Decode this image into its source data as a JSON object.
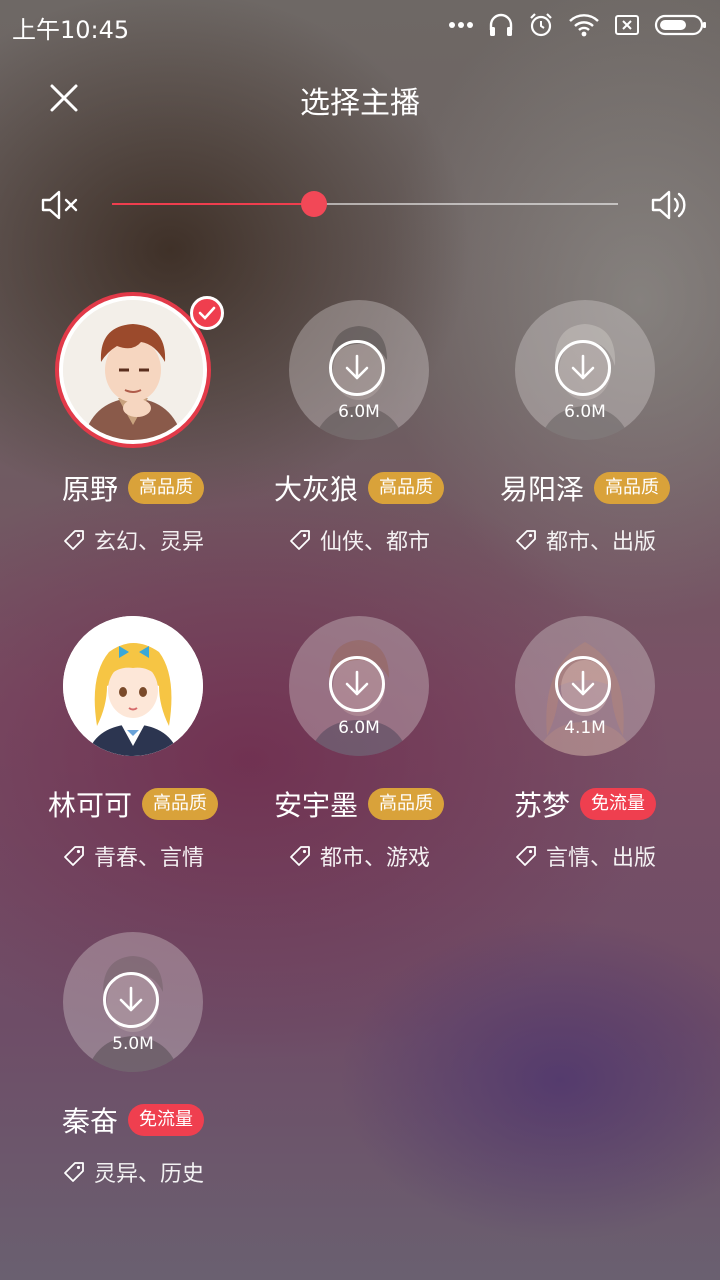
{
  "status_bar": {
    "time": "上午10:45",
    "icons": [
      "more-dots-icon",
      "headphones-icon",
      "alarm-icon",
      "wifi-icon",
      "no-sim-icon",
      "battery-icon"
    ]
  },
  "header": {
    "title": "选择主播",
    "close_icon": "close-icon"
  },
  "volume": {
    "level": 0.4,
    "mute_icon": "volume-mute-icon",
    "up_icon": "volume-up-icon",
    "accent": "#ef3e4e"
  },
  "anchors": [
    {
      "name": "原野",
      "badge": "高品质",
      "badge_type": "gold",
      "tags": "玄幻、灵异",
      "selected": true,
      "downloaded": true,
      "size": ""
    },
    {
      "name": "大灰狼",
      "badge": "高品质",
      "badge_type": "gold",
      "tags": "仙侠、都市",
      "selected": false,
      "downloaded": false,
      "size": "6.0M"
    },
    {
      "name": "易阳泽",
      "badge": "高品质",
      "badge_type": "gold",
      "tags": "都市、出版",
      "selected": false,
      "downloaded": false,
      "size": "6.0M"
    },
    {
      "name": "林可可",
      "badge": "高品质",
      "badge_type": "gold",
      "tags": "青春、言情",
      "selected": false,
      "downloaded": true,
      "size": ""
    },
    {
      "name": "安宇墨",
      "badge": "高品质",
      "badge_type": "gold",
      "tags": "都市、游戏",
      "selected": false,
      "downloaded": false,
      "size": "6.0M"
    },
    {
      "name": "苏梦",
      "badge": "免流量",
      "badge_type": "red",
      "tags": "言情、出版",
      "selected": false,
      "downloaded": false,
      "size": "4.1M"
    },
    {
      "name": "秦奋",
      "badge": "免流量",
      "badge_type": "red",
      "tags": "灵异、历史",
      "selected": false,
      "downloaded": false,
      "size": "5.0M"
    }
  ],
  "colors": {
    "badge_gold": "#d9a23a",
    "badge_red": "#ef3f4f",
    "selected_ring": "#e23a49"
  }
}
